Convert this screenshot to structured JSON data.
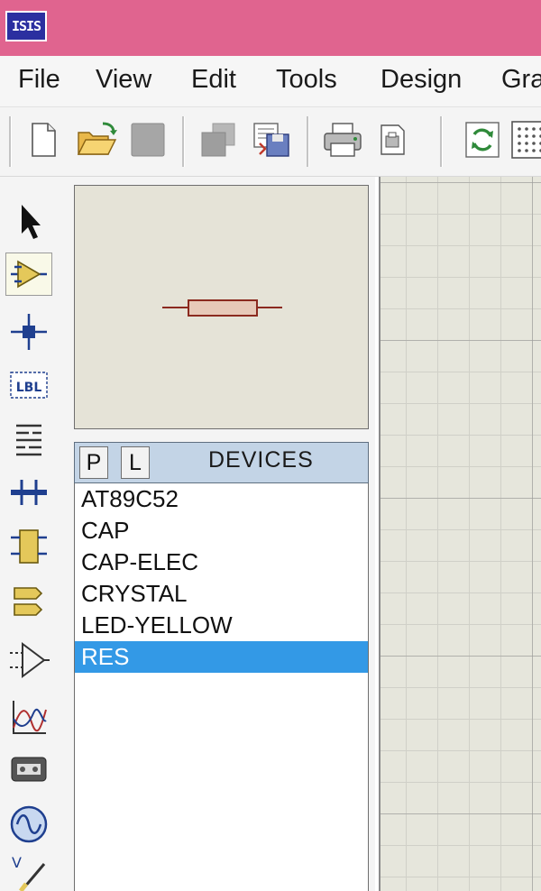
{
  "app": {
    "logo_text": "ISIS"
  },
  "menu": {
    "items": [
      {
        "label": "File"
      },
      {
        "label": "View"
      },
      {
        "label": "Edit"
      },
      {
        "label": "Tools"
      },
      {
        "label": "Design"
      },
      {
        "label": "Gra"
      }
    ]
  },
  "toolbar": {
    "buttons": [
      "new-file-icon",
      "open-folder-icon",
      "save-icon",
      "import-section-icon",
      "export-section-icon",
      "print-icon",
      "print-setup-icon",
      "refresh-icon",
      "grid-icon"
    ]
  },
  "left_tools": {
    "items": [
      "selection-mode-icon",
      "component-mode-icon",
      "junction-dot-icon",
      "wire-label-icon",
      "text-script-icon",
      "bus-icon",
      "sub-circuit-icon",
      "terminal-icon",
      "device-pin-icon",
      "graph-icon",
      "tape-recorder-icon",
      "generator-icon",
      "voltage-probe-icon"
    ]
  },
  "devices": {
    "p_label": "P",
    "l_label": "L",
    "title": "DEVICES",
    "items": [
      {
        "name": "AT89C52"
      },
      {
        "name": "CAP"
      },
      {
        "name": "CAP-ELEC"
      },
      {
        "name": "CRYSTAL"
      },
      {
        "name": "LED-YELLOW"
      },
      {
        "name": "RES"
      }
    ],
    "selected": "RES"
  },
  "colors": {
    "titlebar": "#e0648f",
    "selection": "#3399e6",
    "preview_bg": "#e5e3d7",
    "canvas_bg": "#e6e6dc",
    "devices_header": "#c3d4e6"
  }
}
